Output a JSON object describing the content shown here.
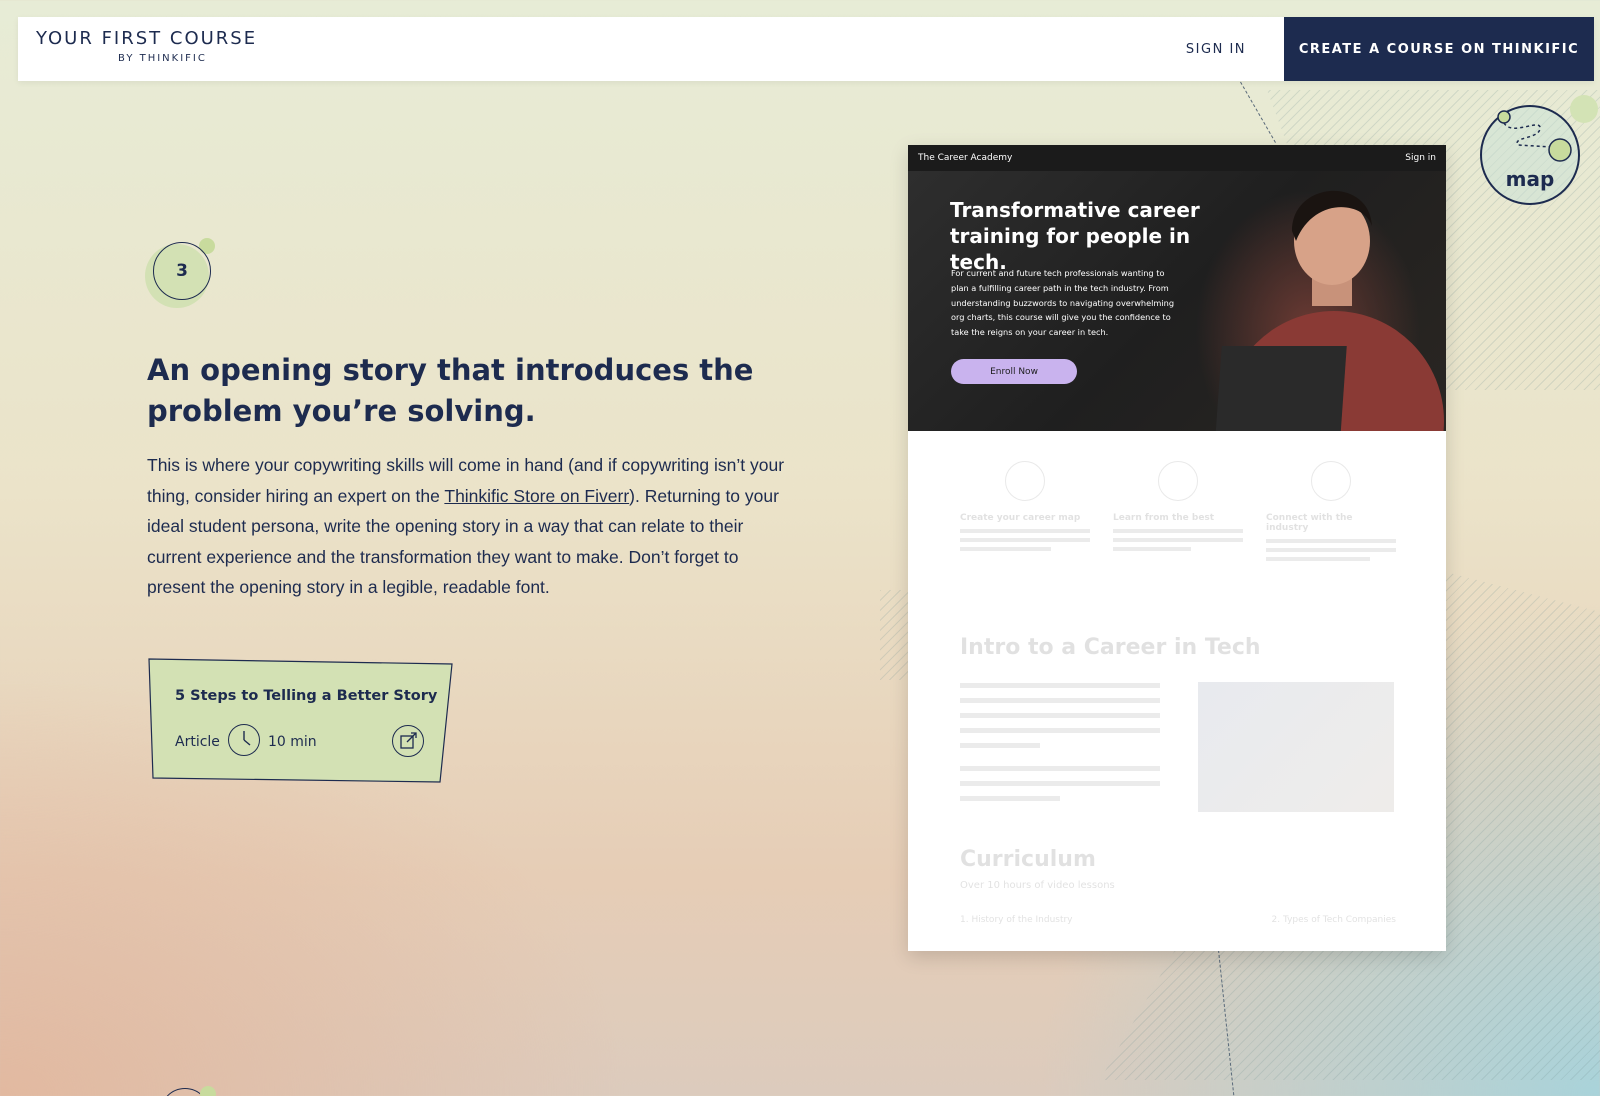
{
  "header": {
    "title": "YOUR FIRST COURSE",
    "subtitle": "BY THINKIFIC",
    "sign_in": "SIGN IN",
    "cta": "CREATE A COURSE ON THINKIFIC"
  },
  "map_badge": {
    "label": "map"
  },
  "step": {
    "number": "3",
    "headline": "An opening story that introduces the problem you’re solving.",
    "body_pre": "This is where your copywriting skills will come in hand (and if copywriting isn’t your thing, consider hiring an expert on the ",
    "body_link": "Thinkific Store on Fiverr",
    "body_post": "). Returning to your ideal student persona, write the opening story in a way that can relate to their current experience and the transformation they want to make. Don’t forget to present the opening story in a legible, readable font."
  },
  "resource": {
    "title": "5 Steps to Telling a Better Story",
    "type": "Article",
    "duration": "10 min",
    "icons": [
      "clock-icon",
      "external-link-icon"
    ]
  },
  "preview": {
    "site_name": "The Career Academy",
    "sign_in": "Sign in",
    "hero_title": "Transformative career training for people in tech.",
    "hero_desc": "For current and future tech professionals wanting to plan a fulfilling career path in the tech industry. From understanding buzzwords to navigating overwhelming org charts, this course will give you the confidence to take the reigns on your career in tech.",
    "enroll": "Enroll Now",
    "features": [
      {
        "title": "Create your career map"
      },
      {
        "title": "Learn from the best"
      },
      {
        "title": "Connect with the industry"
      }
    ],
    "intro_title": "Intro to a Career in Tech",
    "curriculum_title": "Curriculum",
    "curriculum_sub": "Over 10 hours of video lessons",
    "curriculum_items": [
      "1. History of the Industry",
      "2. Types of Tech Companies"
    ]
  },
  "colors": {
    "navy": "#1d2b4f",
    "card_green": "#d3e1b4",
    "enroll_purple": "#c9b3ee"
  }
}
